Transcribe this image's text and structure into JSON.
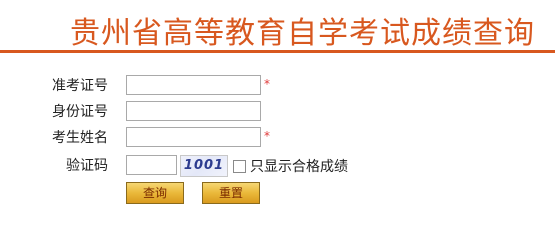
{
  "page": {
    "title": "贵州省高等教育自学考试成绩查询"
  },
  "form": {
    "exam_number": {
      "label": "准考证号",
      "value": "",
      "required_mark": "*"
    },
    "id_number": {
      "label": "身份证号",
      "value": ""
    },
    "name": {
      "label": "考生姓名",
      "value": "",
      "required_mark": "*"
    },
    "captcha": {
      "label": "验证码",
      "value": "",
      "image_text": "1001"
    },
    "pass_only": {
      "label": "只显示合格成绩",
      "checked": false
    },
    "buttons": {
      "query": "查询",
      "reset": "重置"
    }
  },
  "colors": {
    "title": "#d8581f",
    "required": "#e03a3a",
    "button_fill": "#eab83a",
    "button_text": "#7a2a00"
  }
}
